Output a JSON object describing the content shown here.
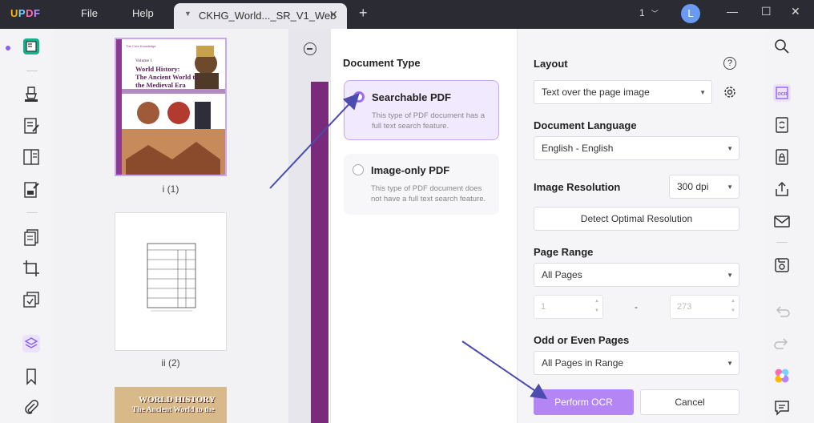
{
  "app": {
    "menu_file": "File",
    "menu_help": "Help",
    "tab_title": "CKHG_World..._SR_V1_Web",
    "page_count": "1",
    "avatar_letter": "L",
    "accent": "#9b6cf0",
    "titlebar_bg": "#2b2c33"
  },
  "thumbnails": [
    {
      "label": "i (1)",
      "cover_lines": [
        "Volume 1",
        "World History:",
        "The Ancient World to",
        "the Medieval Era"
      ]
    },
    {
      "label": "ii (2)"
    },
    {
      "cover_lines": [
        "WORLD HISTORY",
        "The Ancient World to the"
      ]
    }
  ],
  "ocr": {
    "document_type_heading": "Document Type",
    "options": [
      {
        "title": "Searchable PDF",
        "desc": "This type of PDF document has a full text search feature.",
        "selected": true
      },
      {
        "title": "Image-only PDF",
        "desc": "This type of PDF document does not have a full text search feature.",
        "selected": false
      }
    ],
    "layout_heading": "Layout",
    "layout_value": "Text over the page image",
    "language_heading": "Document Language",
    "language_value": "English - English",
    "resolution_heading": "Image Resolution",
    "resolution_value": "300 dpi",
    "detect_button": "Detect Optimal Resolution",
    "page_range_heading": "Page Range",
    "page_range_value": "All Pages",
    "range_from": "1",
    "range_dash": "-",
    "range_to": "273",
    "odd_even_heading": "Odd or Even Pages",
    "odd_even_value": "All Pages in Range",
    "perform_button": "Perform OCR",
    "cancel_button": "Cancel"
  },
  "icons": {
    "left_toolbar": [
      "reader-icon",
      "highlighter-icon",
      "edit-text-icon",
      "page-layout-icon",
      "form-icon",
      "organize-pages-icon",
      "crop-icon",
      "ocr-pages-icon",
      "layers-icon",
      "bookmark-icon",
      "attachment-icon"
    ],
    "right_toolbar": [
      "search-icon",
      "ocr-icon",
      "convert-icon",
      "protect-icon",
      "share-icon",
      "email-icon",
      "save-icon",
      "undo-icon",
      "redo-icon",
      "ai-assistant-icon",
      "comment-icon"
    ]
  }
}
